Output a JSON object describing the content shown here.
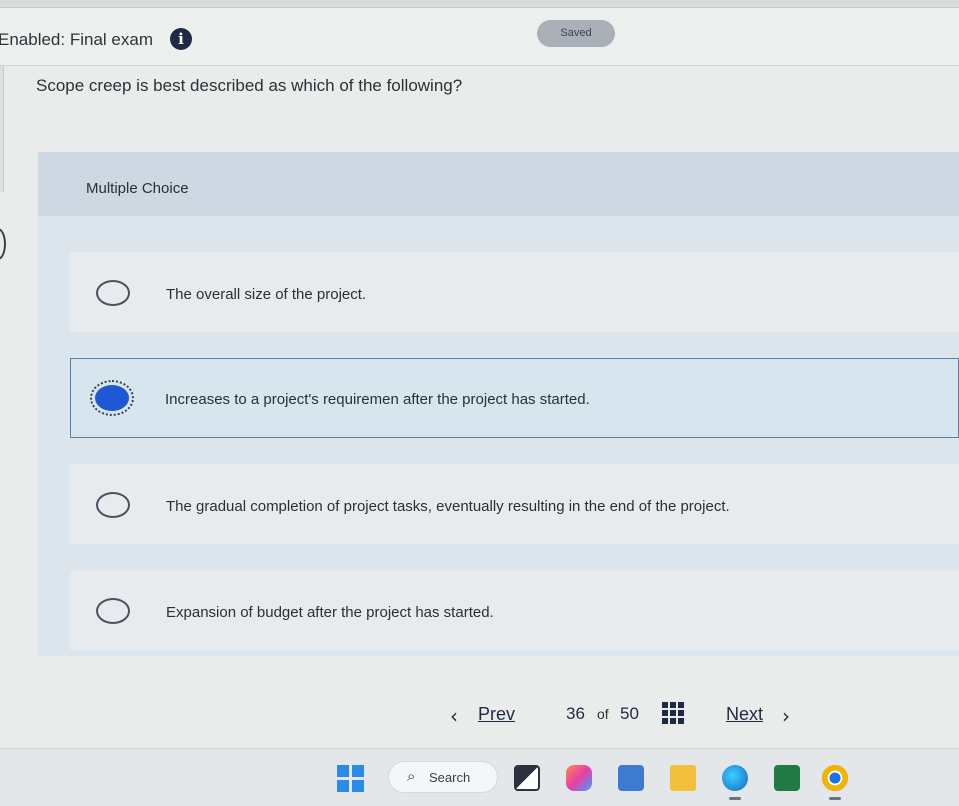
{
  "header": {
    "exam_title": "Enabled: Final exam",
    "info_icon": "info-icon",
    "saved_label": "Saved"
  },
  "question": {
    "text": "Scope creep is best described as which of the following?",
    "type_label": "Multiple Choice"
  },
  "options": [
    {
      "text": "The overall size of the project.",
      "selected": false
    },
    {
      "text": "Increases to a project's requiremen   after the project has started.",
      "selected": true
    },
    {
      "text": "The gradual completion of project tasks, eventually resulting in the end of the project.",
      "selected": false
    },
    {
      "text": "Expansion of budget after the project has started.",
      "selected": false
    }
  ],
  "navigation": {
    "prev_label": "Prev",
    "current_page": "36",
    "of_label": "of",
    "total_pages": "50",
    "next_label": "Next"
  },
  "taskbar": {
    "search_label": "Search",
    "apps": [
      "windows-start-icon",
      "task-view-icon",
      "copilot-icon",
      "calculator-icon",
      "file-explorer-icon",
      "edge-icon",
      "excel-icon",
      "chrome-icon"
    ]
  },
  "colors": {
    "selected_radio": "#1f58d6",
    "mc_header_bg": "#cdd8e3",
    "options_bg": "#dce4ec",
    "nav_text": "#1f2a44"
  }
}
